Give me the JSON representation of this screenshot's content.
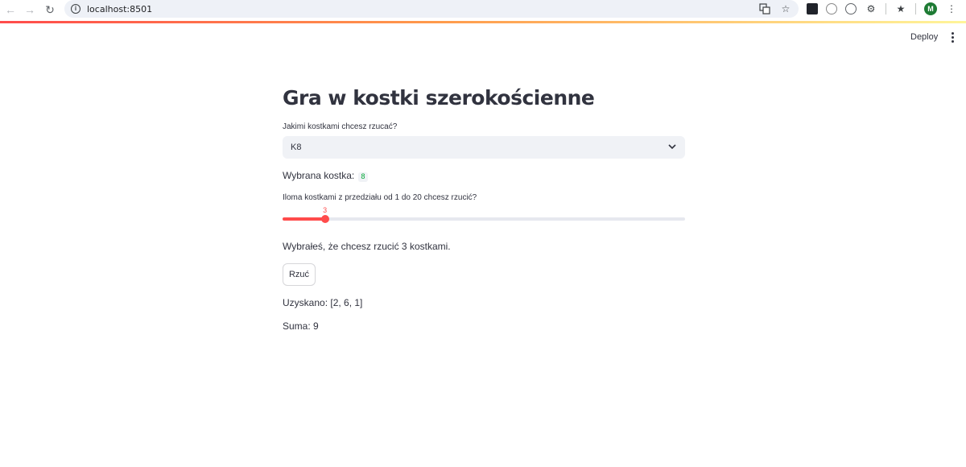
{
  "browser": {
    "url": "localhost:8501",
    "avatar_letter": "M"
  },
  "header": {
    "deploy_label": "Deploy"
  },
  "main": {
    "title": "Gra w kostki szerokościenne",
    "dice_select": {
      "label": "Jakimi kostkami chcesz rzucać?",
      "value": "K8"
    },
    "chosen_dice": {
      "label": "Wybrana kostka:",
      "value": "8"
    },
    "count_slider": {
      "label": "Iloma kostkami z przedziału od 1 do 20 chcesz rzucić?",
      "value": 3,
      "min": 1,
      "max": 20,
      "value_text": "3"
    },
    "chosen_count_text": "Wybrałeś, że chcesz rzucić 3 kostkami.",
    "roll_button_label": "Rzuć",
    "result_text": "Uzyskano: [2, 6, 1]",
    "sum_text": "Suma: 9"
  },
  "colors": {
    "accent": "#ff4b4b",
    "code_green": "#09ab3b",
    "text": "#31333f",
    "input_bg": "#f0f2f6"
  }
}
